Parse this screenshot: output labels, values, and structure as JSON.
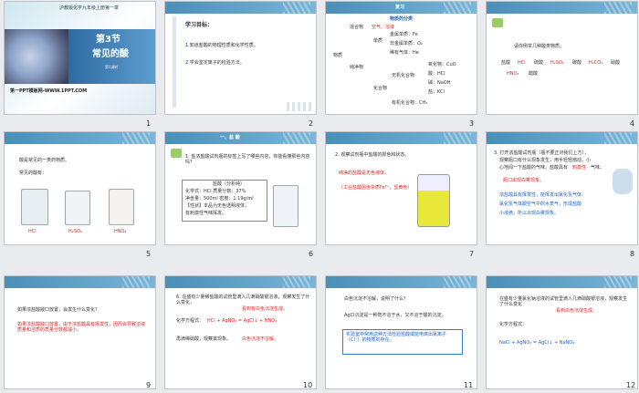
{
  "slides": [
    {
      "n": "1",
      "header": "沪教版化学九年级上册第一章",
      "title": "第3节",
      "subtitle": "常见的酸",
      "sub2": "第1课时",
      "footer": "第一PPT模板网-WWW.1PPT.COM"
    },
    {
      "n": "2",
      "heading": "学习目标：",
      "lines": [
        "1.知道盐酸的物理性质和化学性质。",
        "2.学会鉴定离子的检验方法。"
      ]
    },
    {
      "n": "3",
      "band": "复习",
      "title": "物质的分类",
      "a": "混合物",
      "a2": "空气、溶液",
      "b": "物质",
      "c": "纯净物",
      "d": "单质",
      "d1": "金属单质：Fe",
      "d2": "非金属单质：O₂",
      "d3": "稀有气体：He",
      "e": "化合物",
      "e1": "无机化合物",
      "e11": "氧化物：CuO",
      "e12": "酸：HCl",
      "e13": "碱：NaOH",
      "e14": "盐：KCl",
      "e2": "有机化合物：CH₄"
    },
    {
      "n": "4",
      "q": "请你例举几种酸类物质。",
      "items": [
        "盐酸",
        "HCl",
        "硫酸",
        "H₂SO₄",
        "碳酸",
        "H₂CO₃",
        "硝酸",
        "HNO₃",
        "醋酸"
      ]
    },
    {
      "n": "5",
      "l1": "酸是常见的一类药物质。",
      "l2": "常见的酸有：",
      "labels": [
        "HCl",
        "H₂SO₄",
        "HNO₃"
      ]
    },
    {
      "n": "6",
      "band": "一、盐 酸",
      "q": "1. 盐浓盐酸试剂瓶的标签上写了哪些内容，你能看懂那些内容吗？",
      "label": [
        "盐酸（分析纯）",
        "化学式：HCl  质量分数：37%",
        "净含量：500ml  密度：1.19g/ml",
        "【性状】本品为无色透明液体，",
        "有刺激性气味挥发。"
      ]
    },
    {
      "n": "7",
      "l1": "2. 观察试剂瓶中盐酸的颜色和状态。",
      "l2": "纯净的盐酸是无色液体。",
      "l3": "（工业盐酸因含杂质Fe³⁺，显黄色）"
    },
    {
      "n": "8",
      "l1": "3. 打开浓盐酸试剂瓶（瓶不要正对我们上方），",
      "l2": "观察瓶口有什么现象发生，用手轻轻扇动，小",
      "l3": "心地闻一下盐酸的气味。盐酸具有",
      "l3r": "刺激性",
      "l3e": "气味。",
      "l4": "瓶口出现白雾现象。",
      "l5": "浓盐酸具有挥发性，能挥发出氯化氢气体。",
      "l6": "氯化氢气体跟空气中的水蒸气，形成盐酸",
      "l7": "小液滴，所以出现白雾现象。"
    },
    {
      "n": "9",
      "q": "如果浓盐酸敞口放置，会发生什么变化？",
      "a": "如果浓盐酸敞口放置，由于浓盐酸具有挥发性，因而会导致溶液质量和溶质的质量分数都减小。"
    },
    {
      "n": "10",
      "q": "6. 在盛有少量稀盐酸的试管里滴入几滴硝酸银溶液，观察发生了什么变化，",
      "qr": "看到有白色沉淀生成。",
      "eq_label": "化学方程式：",
      "eq": "HCl + AgNO₃ = AgCl↓ + HNO₃",
      "l2": "再滴稀硝酸，观察其现象。",
      "l2r": "白色沉淀不溶解。"
    },
    {
      "n": "11",
      "q": "白色沉淀不溶解，说明了什么？",
      "a": "AgCl沉淀是一种既不溶于水，又不溶于酸的沉淀。",
      "box": "实验室中常用这种方法检验盐酸或能电离出氯离子（Cl⁻）的物质的存在。"
    },
    {
      "n": "12",
      "q": "在盛有少量氯化钠溶液的试管里滴入几滴硝酸银溶液，观察发生了什么变化",
      "qr": "看到白色沉淀生成。",
      "eq_label": "化学方程式：",
      "eq": "NaCl + AgNO₃ = AgCl↓ + NaNO₃"
    }
  ]
}
